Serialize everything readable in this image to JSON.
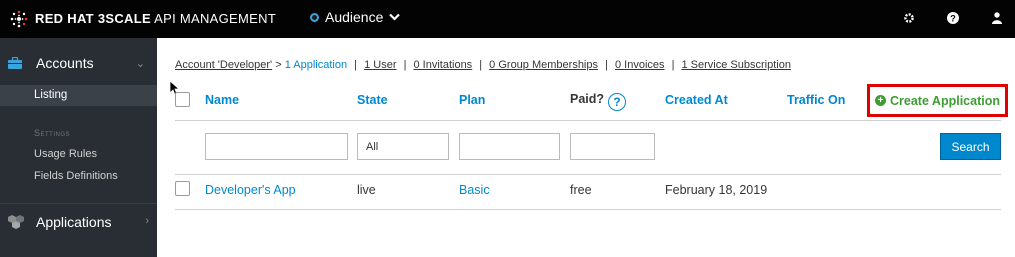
{
  "header": {
    "brand_bold": "RED HAT 3SCALE",
    "brand_rest": "API MANAGEMENT",
    "context_selector": "Audience",
    "icons": [
      "gear-icon",
      "question-icon",
      "user-icon"
    ]
  },
  "sidebar": {
    "accounts_label": "Accounts",
    "listing_label": "Listing",
    "settings_heading": "Settings",
    "usage_rules_label": "Usage Rules",
    "fields_definitions_label": "Fields Definitions",
    "applications_label": "Applications"
  },
  "breadcrumb": {
    "account": "Account 'Developer'",
    "separator": ">",
    "applications": "1 Application",
    "users": "1 User",
    "invitations": "0 Invitations",
    "group_memberships": "0 Group Memberships",
    "invoices": "0 Invoices",
    "service_subscriptions": "1 Service Subscription",
    "pipe": "|"
  },
  "table": {
    "columns": {
      "name": "Name",
      "state": "State",
      "plan": "Plan",
      "paid": "Paid?",
      "created_at": "Created At",
      "traffic_on": "Traffic On"
    },
    "help_glyph": "?",
    "create_button": "Create Application",
    "filters": {
      "state_value": "All",
      "search_button": "Search"
    },
    "rows": [
      {
        "name": "Developer's App",
        "state": "live",
        "plan": "Basic",
        "paid": "free",
        "created_at": "February 18, 2019"
      }
    ]
  },
  "colors": {
    "accent_blue": "#0088ce",
    "create_green": "#3f9c35",
    "highlight_red": "#e00000",
    "sidebar_bg": "#292e34",
    "topbar_bg": "#030303"
  }
}
